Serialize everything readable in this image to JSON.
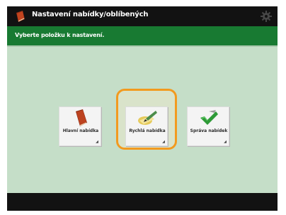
{
  "window": {
    "title": "Nastavení nabídky/oblíbených",
    "subtitle": "Vyberte položku k nastavení."
  },
  "icons": {
    "app": "red-book-icon",
    "settings": "gear-icon"
  },
  "tiles": [
    {
      "label": "Hlavní nabídka",
      "icon": "red-book-icon",
      "selected": false
    },
    {
      "label": "Rychlá nabídka",
      "icon": "pencil-note-icon",
      "selected": true
    },
    {
      "label": "Správa nabídek",
      "icon": "green-checkmark-icon",
      "selected": false
    }
  ],
  "colors": {
    "title_bar": "#121212",
    "subtitle_bar": "#187a32",
    "content_bg": "#c5dec8",
    "selection": "#f29a1f"
  }
}
